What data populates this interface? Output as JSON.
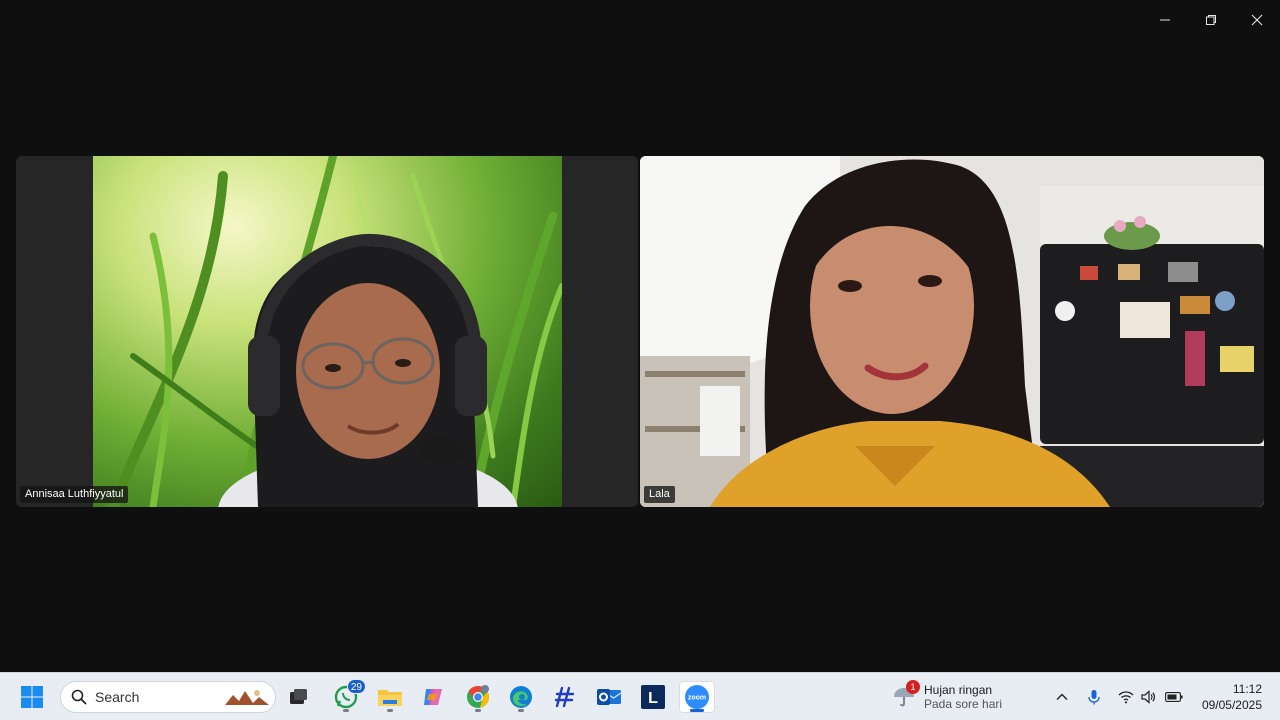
{
  "window": {
    "controls": {
      "minimize": "minimize",
      "restore": "restore",
      "close": "close"
    }
  },
  "participants": [
    {
      "name": "Annisaa Luthfiyyatul"
    },
    {
      "name": "Lala"
    }
  ],
  "taskbar": {
    "search": {
      "placeholder": "Search"
    },
    "apps": [
      {
        "icon": "task-view-icon"
      },
      {
        "icon": "whatsapp-icon",
        "badge": "29"
      },
      {
        "icon": "file-explorer-icon"
      },
      {
        "icon": "copilot-icon"
      },
      {
        "icon": "chrome-icon"
      },
      {
        "icon": "edge-icon"
      },
      {
        "icon": "slash-app-icon"
      },
      {
        "icon": "outlook-icon"
      },
      {
        "icon": "l-app-icon",
        "label": "L"
      },
      {
        "icon": "zoom-icon",
        "label": "zoom"
      }
    ],
    "weather": {
      "badge": "1",
      "line1": "Hujan ringan",
      "line2": "Pada sore hari"
    },
    "clock": {
      "time": "11:12",
      "date": "09/05/2025"
    }
  },
  "colors": {
    "background": "#0f0f10",
    "taskbar": "#e8edf4",
    "accent": "#1463d8",
    "zoom": "#2d8cff",
    "whatsapp": "#25d366"
  }
}
